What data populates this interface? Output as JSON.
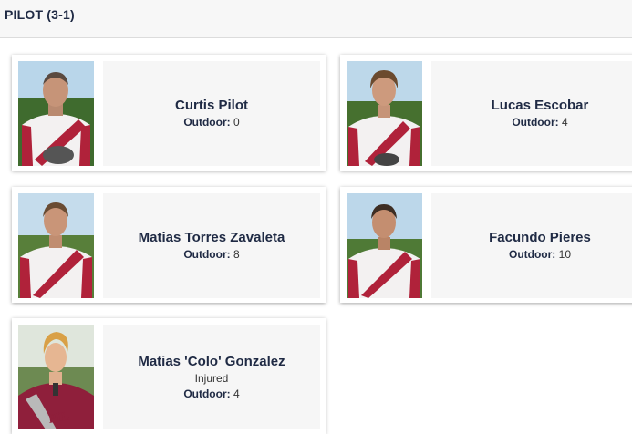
{
  "team": {
    "title": "PILOT (3-1)"
  },
  "outdoor_label": "Outdoor:",
  "colors": {
    "jersey": "#b0223a",
    "shirt_white": "#f3f1f1",
    "name_text": "#1f2a44"
  },
  "players": [
    {
      "name": "Curtis Pilot",
      "status": "",
      "outdoor_value": "0"
    },
    {
      "name": "Lucas Escobar",
      "status": "",
      "outdoor_value": "4"
    },
    {
      "name": "Matias Torres Zavaleta",
      "status": "",
      "outdoor_value": "8"
    },
    {
      "name": "Facundo Pieres",
      "status": "",
      "outdoor_value": "10"
    },
    {
      "name": "Matias 'Colo' Gonzalez",
      "status": "Injured",
      "outdoor_value": "4"
    }
  ]
}
